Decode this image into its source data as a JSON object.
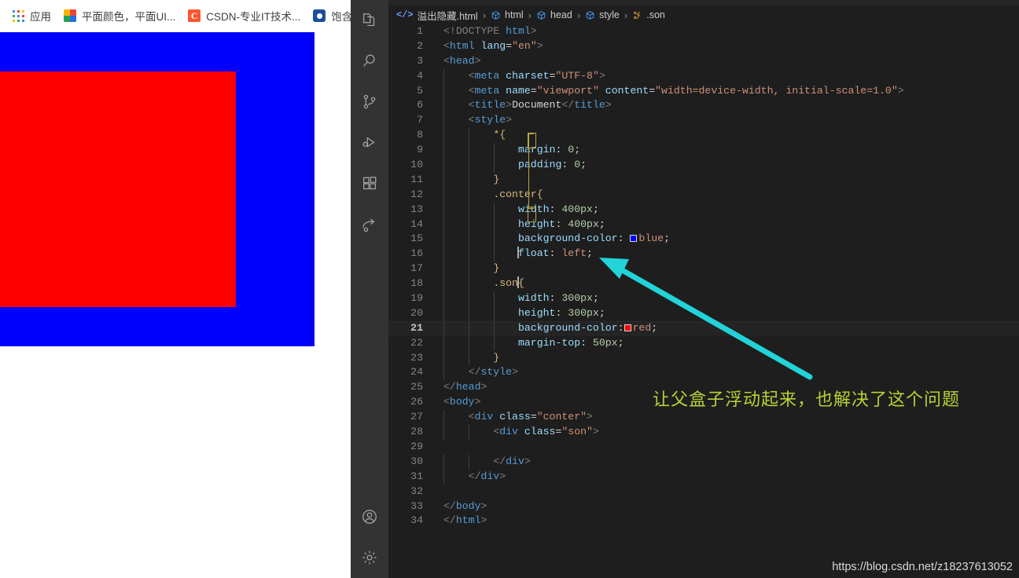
{
  "browser": {
    "bookmarks": [
      {
        "icon": "apps-grid-icon",
        "label": "应用"
      },
      {
        "icon": "color-palette-favicon",
        "label": "平面颜色，平面UI..."
      },
      {
        "icon": "csdn-favicon",
        "label": "CSDN-专业IT技术..."
      },
      {
        "icon": "blue-circle-favicon",
        "label": "饱含诗"
      }
    ],
    "render": {
      "parent_box_color": "#0000ff",
      "child_box_color": "#ff0000",
      "parent_box_name": "conter",
      "child_box_name": "son"
    }
  },
  "vscode": {
    "activity_bar": {
      "top_icons": [
        "explorer-icon",
        "search-icon",
        "source-control-icon",
        "run-and-debug-icon",
        "extensions-icon",
        "remote-explorer-icon"
      ],
      "bottom_icons": [
        "account-icon",
        "settings-gear-icon"
      ]
    },
    "breadcrumb": {
      "file_icon": "html-file-icon",
      "file_name": "溢出隐藏.html",
      "separator": "›",
      "items": [
        {
          "icon": "symbol-cube-icon",
          "label": "html"
        },
        {
          "icon": "symbol-cube-icon",
          "label": "head"
        },
        {
          "icon": "symbol-cube-icon",
          "label": "style"
        },
        {
          "icon": "symbol-css-rule-icon",
          "label": ".son"
        }
      ]
    },
    "active_line_number": 21,
    "code_lines": [
      {
        "n": 1,
        "tokens": [
          {
            "c": "t-punc",
            "t": "<!DOCTYPE "
          },
          {
            "c": "t-tag",
            "t": "html"
          },
          {
            "c": "t-punc",
            "t": ">"
          }
        ]
      },
      {
        "n": 2,
        "tokens": [
          {
            "c": "t-punc",
            "t": "<"
          },
          {
            "c": "t-tag",
            "t": "html "
          },
          {
            "c": "t-attr",
            "t": "lang"
          },
          {
            "c": "t-eq",
            "t": "="
          },
          {
            "c": "t-str",
            "t": "\"en\""
          },
          {
            "c": "t-punc",
            "t": ">"
          }
        ]
      },
      {
        "n": 3,
        "tokens": [
          {
            "c": "t-punc",
            "t": "<"
          },
          {
            "c": "t-tag",
            "t": "head"
          },
          {
            "c": "t-punc",
            "t": ">"
          }
        ]
      },
      {
        "n": 4,
        "tokens": [
          {
            "c": "t-txt",
            "t": "    "
          },
          {
            "c": "t-punc",
            "t": "<"
          },
          {
            "c": "t-tag",
            "t": "meta "
          },
          {
            "c": "t-attr",
            "t": "charset"
          },
          {
            "c": "t-eq",
            "t": "="
          },
          {
            "c": "t-str",
            "t": "\"UTF-8\""
          },
          {
            "c": "t-punc",
            "t": ">"
          }
        ]
      },
      {
        "n": 5,
        "tokens": [
          {
            "c": "t-txt",
            "t": "    "
          },
          {
            "c": "t-punc",
            "t": "<"
          },
          {
            "c": "t-tag",
            "t": "meta "
          },
          {
            "c": "t-attr",
            "t": "name"
          },
          {
            "c": "t-eq",
            "t": "="
          },
          {
            "c": "t-str",
            "t": "\"viewport\""
          },
          {
            "c": "t-txt",
            "t": " "
          },
          {
            "c": "t-attr",
            "t": "content"
          },
          {
            "c": "t-eq",
            "t": "="
          },
          {
            "c": "t-str",
            "t": "\"width=device-width, initial-scale=1.0\""
          },
          {
            "c": "t-punc",
            "t": ">"
          }
        ]
      },
      {
        "n": 6,
        "tokens": [
          {
            "c": "t-txt",
            "t": "    "
          },
          {
            "c": "t-punc",
            "t": "<"
          },
          {
            "c": "t-tag",
            "t": "title"
          },
          {
            "c": "t-punc",
            "t": ">"
          },
          {
            "c": "t-txt",
            "t": "Document"
          },
          {
            "c": "t-punc",
            "t": "</"
          },
          {
            "c": "t-tag",
            "t": "title"
          },
          {
            "c": "t-punc",
            "t": ">"
          }
        ]
      },
      {
        "n": 7,
        "tokens": [
          {
            "c": "t-txt",
            "t": "    "
          },
          {
            "c": "t-punc",
            "t": "<"
          },
          {
            "c": "t-tag",
            "t": "style"
          },
          {
            "c": "t-punc",
            "t": ">"
          }
        ]
      },
      {
        "n": 8,
        "tokens": [
          {
            "c": "t-txt",
            "t": "        "
          },
          {
            "c": "t-sel",
            "t": "*"
          },
          {
            "c": "t-brace",
            "t": "{"
          }
        ]
      },
      {
        "n": 9,
        "tokens": [
          {
            "c": "t-txt",
            "t": "            "
          },
          {
            "c": "t-prop",
            "t": "margin"
          },
          {
            "c": "t-txt",
            "t": ": "
          },
          {
            "c": "t-num",
            "t": "0"
          },
          {
            "c": "t-txt",
            "t": ";"
          }
        ]
      },
      {
        "n": 10,
        "tokens": [
          {
            "c": "t-txt",
            "t": "            "
          },
          {
            "c": "t-prop",
            "t": "padding"
          },
          {
            "c": "t-txt",
            "t": ": "
          },
          {
            "c": "t-num",
            "t": "0"
          },
          {
            "c": "t-txt",
            "t": ";"
          }
        ]
      },
      {
        "n": 11,
        "tokens": [
          {
            "c": "t-txt",
            "t": "        "
          },
          {
            "c": "t-brace",
            "t": "}"
          }
        ]
      },
      {
        "n": 12,
        "tokens": [
          {
            "c": "t-txt",
            "t": "        "
          },
          {
            "c": "t-sel",
            "t": ".conter"
          },
          {
            "c": "t-brace",
            "t": "{"
          }
        ]
      },
      {
        "n": 13,
        "tokens": [
          {
            "c": "t-txt",
            "t": "            "
          },
          {
            "c": "t-prop",
            "t": "width"
          },
          {
            "c": "t-txt",
            "t": ": "
          },
          {
            "c": "t-num",
            "t": "400px"
          },
          {
            "c": "t-txt",
            "t": ";"
          }
        ]
      },
      {
        "n": 14,
        "tokens": [
          {
            "c": "t-txt",
            "t": "            "
          },
          {
            "c": "t-prop",
            "t": "height"
          },
          {
            "c": "t-txt",
            "t": ": "
          },
          {
            "c": "t-num",
            "t": "400px"
          },
          {
            "c": "t-txt",
            "t": ";"
          }
        ]
      },
      {
        "n": 15,
        "tokens": [
          {
            "c": "t-txt",
            "t": "            "
          },
          {
            "c": "t-prop",
            "t": "background-color"
          },
          {
            "c": "t-txt",
            "t": ": "
          },
          {
            "c": "swatch",
            "t": "#0000ff"
          },
          {
            "c": "t-val",
            "t": "blue"
          },
          {
            "c": "t-txt",
            "t": ";"
          }
        ]
      },
      {
        "n": 16,
        "tokens": [
          {
            "c": "t-txt",
            "t": "            "
          },
          {
            "c": "cursor",
            "t": ""
          },
          {
            "c": "t-prop",
            "t": "float"
          },
          {
            "c": "t-txt",
            "t": ": "
          },
          {
            "c": "t-val",
            "t": "left"
          },
          {
            "c": "t-txt",
            "t": ";"
          }
        ]
      },
      {
        "n": 17,
        "tokens": [
          {
            "c": "t-txt",
            "t": "        "
          },
          {
            "c": "t-brace",
            "t": "}"
          }
        ]
      },
      {
        "n": 18,
        "tokens": [
          {
            "c": "t-txt",
            "t": "        "
          },
          {
            "c": "t-sel",
            "t": ".son"
          },
          {
            "c": "cursor",
            "t": ""
          },
          {
            "c": "t-brace",
            "t": "{"
          }
        ]
      },
      {
        "n": 19,
        "tokens": [
          {
            "c": "t-txt",
            "t": "            "
          },
          {
            "c": "t-prop",
            "t": "width"
          },
          {
            "c": "t-txt",
            "t": ": "
          },
          {
            "c": "t-num",
            "t": "300px"
          },
          {
            "c": "t-txt",
            "t": ";"
          }
        ]
      },
      {
        "n": 20,
        "tokens": [
          {
            "c": "t-txt",
            "t": "            "
          },
          {
            "c": "t-prop",
            "t": "height"
          },
          {
            "c": "t-txt",
            "t": ": "
          },
          {
            "c": "t-num",
            "t": "300px"
          },
          {
            "c": "t-txt",
            "t": ";"
          }
        ]
      },
      {
        "n": 21,
        "tokens": [
          {
            "c": "t-txt",
            "t": "            "
          },
          {
            "c": "t-prop",
            "t": "background-color"
          },
          {
            "c": "t-txt",
            "t": ":"
          },
          {
            "c": "swatch",
            "t": "#ff0000"
          },
          {
            "c": "t-val",
            "t": "red"
          },
          {
            "c": "t-txt",
            "t": ";"
          }
        ]
      },
      {
        "n": 22,
        "tokens": [
          {
            "c": "t-txt",
            "t": "            "
          },
          {
            "c": "t-prop",
            "t": "margin-top"
          },
          {
            "c": "t-txt",
            "t": ": "
          },
          {
            "c": "t-num",
            "t": "50px"
          },
          {
            "c": "t-txt",
            "t": ";"
          }
        ]
      },
      {
        "n": 23,
        "tokens": [
          {
            "c": "t-txt",
            "t": "        "
          },
          {
            "c": "t-brace",
            "t": "}"
          }
        ]
      },
      {
        "n": 24,
        "tokens": [
          {
            "c": "t-txt",
            "t": "    "
          },
          {
            "c": "t-punc",
            "t": "</"
          },
          {
            "c": "t-tag",
            "t": "style"
          },
          {
            "c": "t-punc",
            "t": ">"
          }
        ]
      },
      {
        "n": 25,
        "tokens": [
          {
            "c": "t-punc",
            "t": "</"
          },
          {
            "c": "t-tag",
            "t": "head"
          },
          {
            "c": "t-punc",
            "t": ">"
          }
        ]
      },
      {
        "n": 26,
        "tokens": [
          {
            "c": "t-punc",
            "t": "<"
          },
          {
            "c": "t-tag",
            "t": "body"
          },
          {
            "c": "t-punc",
            "t": ">"
          }
        ]
      },
      {
        "n": 27,
        "tokens": [
          {
            "c": "t-txt",
            "t": "    "
          },
          {
            "c": "t-punc",
            "t": "<"
          },
          {
            "c": "t-tag",
            "t": "div "
          },
          {
            "c": "t-attr",
            "t": "class"
          },
          {
            "c": "t-eq",
            "t": "="
          },
          {
            "c": "t-str",
            "t": "\"conter\""
          },
          {
            "c": "t-punc",
            "t": ">"
          }
        ]
      },
      {
        "n": 28,
        "tokens": [
          {
            "c": "t-txt",
            "t": "        "
          },
          {
            "c": "t-punc",
            "t": "<"
          },
          {
            "c": "t-tag",
            "t": "div "
          },
          {
            "c": "t-attr",
            "t": "class"
          },
          {
            "c": "t-eq",
            "t": "="
          },
          {
            "c": "t-str",
            "t": "\"son\""
          },
          {
            "c": "t-punc",
            "t": ">"
          }
        ]
      },
      {
        "n": 29,
        "tokens": [
          {
            "c": "t-txt",
            "t": ""
          }
        ]
      },
      {
        "n": 30,
        "tokens": [
          {
            "c": "t-txt",
            "t": "        "
          },
          {
            "c": "t-punc",
            "t": "</"
          },
          {
            "c": "t-tag",
            "t": "div"
          },
          {
            "c": "t-punc",
            "t": ">"
          }
        ]
      },
      {
        "n": 31,
        "tokens": [
          {
            "c": "t-txt",
            "t": "    "
          },
          {
            "c": "t-punc",
            "t": "</"
          },
          {
            "c": "t-tag",
            "t": "div"
          },
          {
            "c": "t-punc",
            "t": ">"
          }
        ]
      },
      {
        "n": 32,
        "tokens": [
          {
            "c": "t-txt",
            "t": ""
          }
        ]
      },
      {
        "n": 33,
        "tokens": [
          {
            "c": "t-punc",
            "t": "</"
          },
          {
            "c": "t-tag",
            "t": "body"
          },
          {
            "c": "t-punc",
            "t": ">"
          }
        ]
      },
      {
        "n": 34,
        "tokens": [
          {
            "c": "t-punc",
            "t": "</"
          },
          {
            "c": "t-tag",
            "t": "html"
          },
          {
            "c": "t-punc",
            "t": ">"
          }
        ]
      }
    ]
  },
  "annotation": {
    "text": "让父盒子浮动起来，也解决了这个问题",
    "text_color": "#b5d334",
    "arrow_color": "#22d3d8"
  },
  "watermark": {
    "url": "https://blog.csdn.net/z18237613052"
  }
}
